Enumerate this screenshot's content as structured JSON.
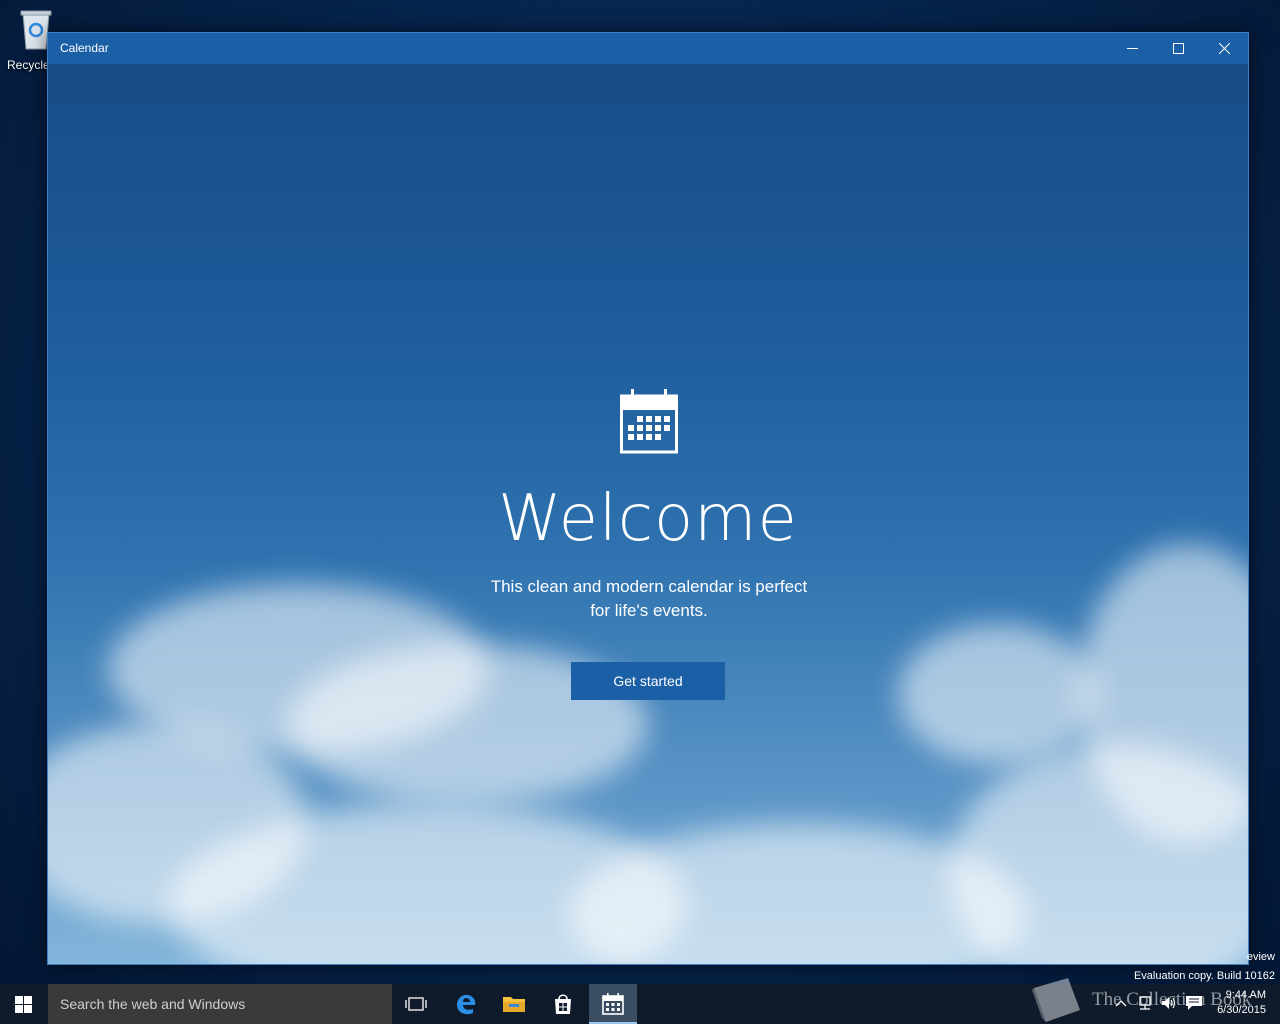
{
  "desktop": {
    "recycle_bin_label": "Recycle",
    "watermark_line1": "eview",
    "watermark_line2": "Evaluation copy. Build 10162"
  },
  "window": {
    "title": "Calendar",
    "minimize_icon": "minimize-icon",
    "maximize_icon": "maximize-icon",
    "close_icon": "close-icon"
  },
  "welcome": {
    "icon": "calendar-icon",
    "title": "Welcome",
    "subtitle_line1": "This clean and modern calendar is perfect",
    "subtitle_line2": "for life's events.",
    "button_label": "Get started"
  },
  "taskbar": {
    "search_placeholder": "Search the web and Windows",
    "icons": [
      "windows-start-icon",
      "task-view-icon",
      "edge-icon",
      "file-explorer-icon",
      "store-icon",
      "calendar-icon"
    ],
    "watermark_text": "The Collection Book",
    "clock_time": "9:44 AM",
    "clock_date": "6/30/2015"
  },
  "colors": {
    "accent": "#1b5fa6",
    "taskbar": "#0f1b2a",
    "search_box": "#3a3a3a"
  }
}
